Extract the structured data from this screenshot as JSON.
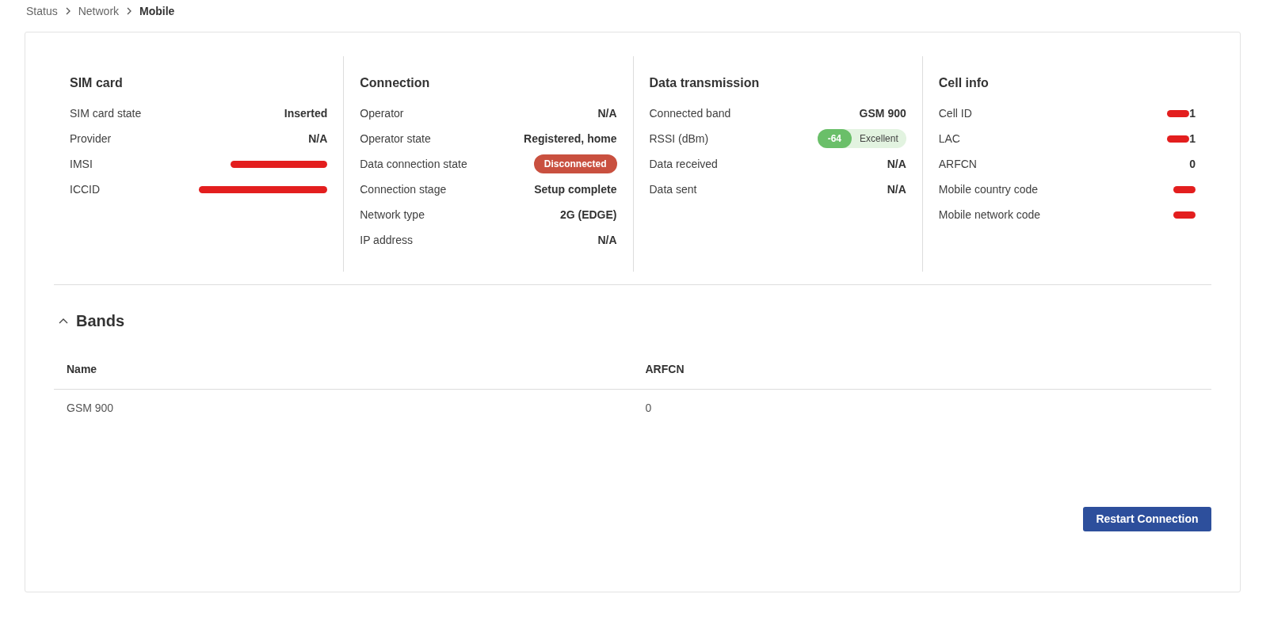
{
  "breadcrumb": [
    {
      "label": "Status",
      "current": false
    },
    {
      "label": "Network",
      "current": false
    },
    {
      "label": "Mobile",
      "current": true
    }
  ],
  "panels": [
    {
      "title": "SIM card",
      "rows": [
        {
          "label": "SIM card state",
          "kind": "text",
          "value": "Inserted"
        },
        {
          "label": "Provider",
          "kind": "text",
          "value": "N/A"
        },
        {
          "label": "IMSI",
          "kind": "redacted"
        },
        {
          "label": "ICCID",
          "kind": "redacted"
        }
      ]
    },
    {
      "title": "Connection",
      "rows": [
        {
          "label": "Operator",
          "kind": "text",
          "value": "N/A"
        },
        {
          "label": "Operator state",
          "kind": "text",
          "value": "Registered, home"
        },
        {
          "label": "Data connection state",
          "kind": "badge",
          "value": "Disconnected",
          "color": "#c9503f"
        },
        {
          "label": "Connection stage",
          "kind": "text",
          "value": "Setup complete"
        },
        {
          "label": "Network type",
          "kind": "text",
          "value": "2G (EDGE)"
        },
        {
          "label": "IP address",
          "kind": "text",
          "value": "N/A"
        }
      ]
    },
    {
      "title": "Data transmission",
      "rows": [
        {
          "label": "Connected band",
          "kind": "text",
          "value": "GSM 900"
        },
        {
          "label": "RSSI (dBm)",
          "kind": "signal",
          "value": "-64",
          "quality": "Excellent"
        },
        {
          "label": "Data received",
          "kind": "text",
          "value": "N/A"
        },
        {
          "label": "Data sent",
          "kind": "text",
          "value": "N/A"
        }
      ]
    },
    {
      "title": "Cell info",
      "rows": [
        {
          "label": "Cell ID",
          "kind": "redacted",
          "value": "1"
        },
        {
          "label": "LAC",
          "kind": "redacted",
          "value": "1"
        },
        {
          "label": "ARFCN",
          "kind": "text",
          "value": "0"
        },
        {
          "label": "Mobile country code",
          "kind": "redacted"
        },
        {
          "label": "Mobile network code",
          "kind": "redacted"
        }
      ]
    }
  ],
  "bands": {
    "title": "Bands",
    "expanded": true,
    "columns": [
      "Name",
      "ARFCN"
    ],
    "rows": [
      [
        "GSM 900",
        "0"
      ]
    ]
  },
  "buttons": [
    "Restart Connection"
  ]
}
